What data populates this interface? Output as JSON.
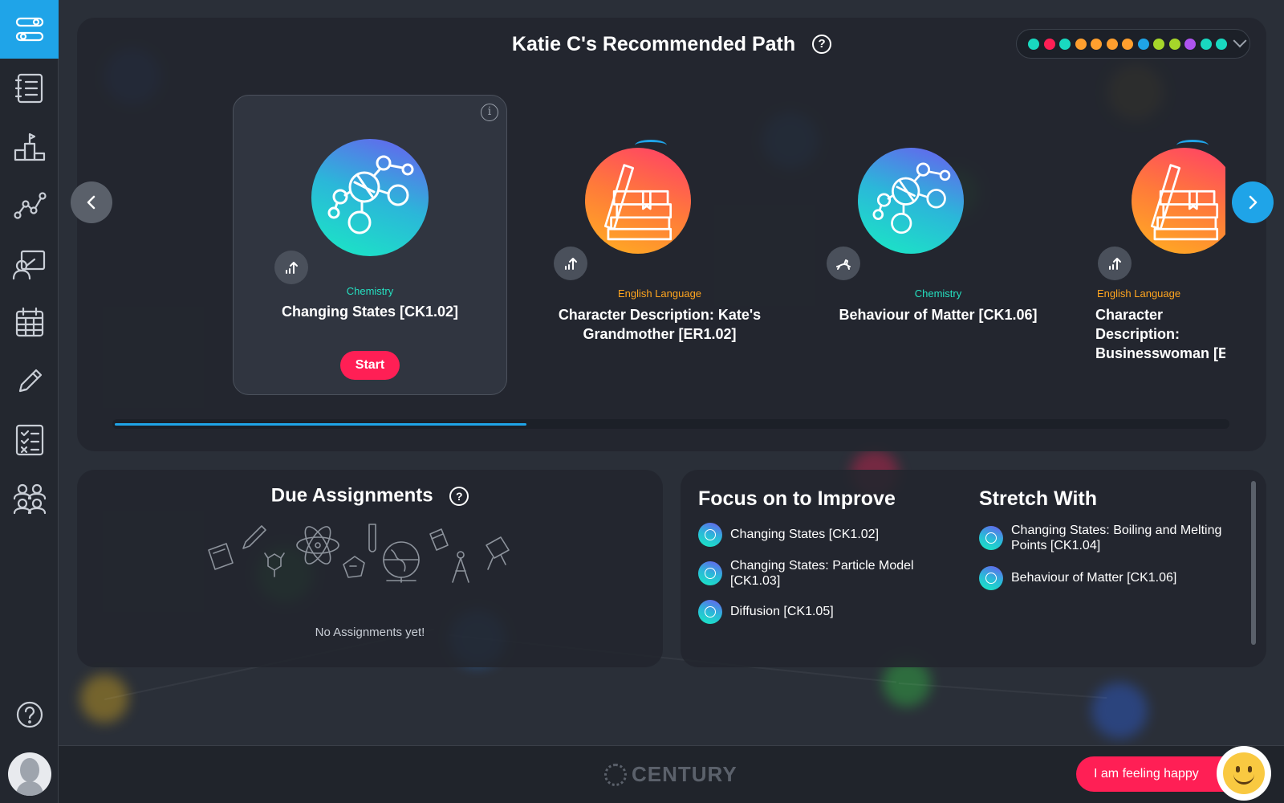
{
  "theme": {
    "accent": "#1fa4e8",
    "danger": "#ff1f55",
    "chemistry": "#25e0c0",
    "english": "#ffa51f"
  },
  "sidebar": {
    "items": [
      {
        "icon": "path-sliders-icon",
        "active": true
      },
      {
        "icon": "courses-list-icon"
      },
      {
        "icon": "leaderboard-icon"
      },
      {
        "icon": "analytics-graph-icon"
      },
      {
        "icon": "teacher-board-icon"
      },
      {
        "icon": "calendar-icon"
      },
      {
        "icon": "pencil-icon"
      },
      {
        "icon": "checklist-icon"
      },
      {
        "icon": "groups-icon"
      }
    ],
    "help_icon": "help-icon"
  },
  "path": {
    "title": "Katie C's Recommended Path",
    "help": "?",
    "subject_filter_colors": [
      "#19d9c0",
      "#ff1f55",
      "#19d9c0",
      "#ff9f2e",
      "#ff9f2e",
      "#ff9f2e",
      "#ff9f2e",
      "#1fa4e8",
      "#a6d62a",
      "#a6d62a",
      "#b054f0",
      "#19d9c0",
      "#19d9c0"
    ],
    "cards": [
      {
        "subject": "Chemistry",
        "name": "Changing States [CK1.02]",
        "start": "Start",
        "badge": "upward-trend-icon"
      },
      {
        "subject": "English Language",
        "name": "Character Description: Kate's Grandmother [ER1.02]",
        "badge": "upward-trend-icon"
      },
      {
        "subject": "Chemistry",
        "name": "Behaviour of Matter [CK1.06]",
        "badge": "running-rabbit-icon"
      },
      {
        "subject": "English Language",
        "name": "Character Description: Businesswoman [E",
        "badge": "upward-trend-icon"
      }
    ],
    "progress": 0.37
  },
  "due": {
    "title": "Due Assignments",
    "help": "?",
    "empty_text": "No Assignments yet!"
  },
  "focus": {
    "title": "Focus on to Improve",
    "items": [
      "Changing States [CK1.02]",
      "Changing States: Particle Model [CK1.03]",
      "Diffusion [CK1.05]"
    ]
  },
  "stretch": {
    "title": "Stretch With",
    "items": [
      "Changing States: Boiling and Melting Points [CK1.04]",
      "Behaviour of Matter [CK1.06]"
    ]
  },
  "footer": {
    "logo": "CENTURY",
    "mood_label": "I am feeling happy"
  }
}
